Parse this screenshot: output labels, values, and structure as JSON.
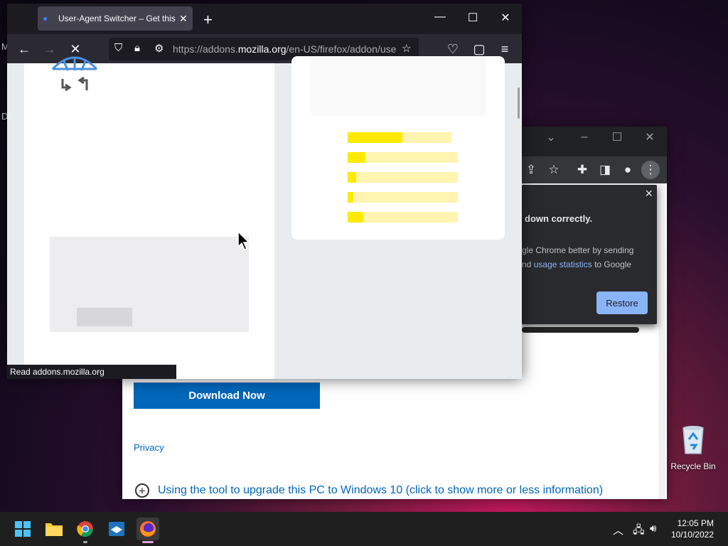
{
  "desktop": {
    "edge_label_m": "M",
    "edge_label_d": "D",
    "recycle_bin_label": "Recycle Bin"
  },
  "chrome_window": {
    "popup": {
      "close_label": "×",
      "title_text": "down correctly.",
      "body_line1": "gle Chrome better by sending",
      "body_line2_prefix": "nd ",
      "body_link": "usage statistics",
      "body_line2_suffix": " to Google",
      "restore_label": "Restore"
    },
    "page": {
      "download_label": "Download Now",
      "privacy_label": "Privacy",
      "expand_text": "Using the tool to upgrade this PC to Windows 10 (click to show more or less information)"
    }
  },
  "firefox_window": {
    "tab_title": "User-Agent Switcher – Get this Extension for Firefox",
    "tab_close": "✕",
    "new_tab": "+",
    "url_prefix": "https://addons.",
    "url_domain": "mozilla.org",
    "url_path": "/en-US/firefox/addon/user-agent-string-switcher/",
    "status_tip": "Read addons.mozilla.org",
    "rating_bars": [
      0.53,
      0.16,
      0.08,
      0.05,
      0.14
    ]
  },
  "taskbar": {
    "time": "12:05 PM",
    "date": "10/10/2022"
  },
  "colors": {
    "firefox_dark": "#1c1b22",
    "chrome_dark": "#202124",
    "ms_blue": "#0067b8",
    "rating_yellow": "#ffe900",
    "restore_blue": "#8ab4f8"
  }
}
